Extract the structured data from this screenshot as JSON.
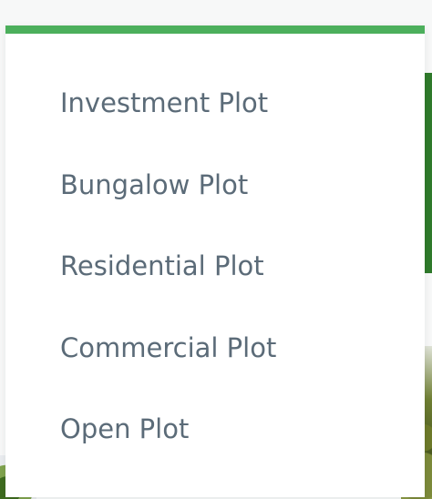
{
  "colors": {
    "accent": "#4caf5c",
    "menu_text": "#5b6b78",
    "panel_bg": "#ffffff"
  },
  "dropdown": {
    "items": [
      {
        "label": "Investment Plot"
      },
      {
        "label": "Bungalow Plot"
      },
      {
        "label": "Residential Plot"
      },
      {
        "label": "Commercial Plot"
      },
      {
        "label": "Open Plot"
      }
    ]
  }
}
